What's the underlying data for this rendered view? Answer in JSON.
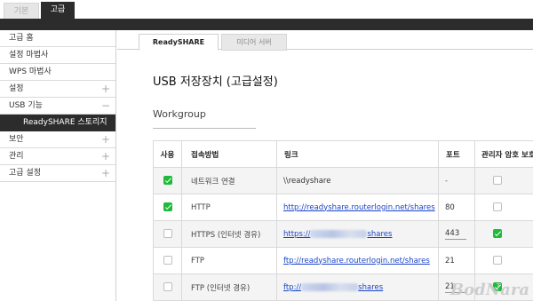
{
  "top_tabs": {
    "basic": "기본",
    "advanced": "고급"
  },
  "sidebar": {
    "items": [
      {
        "label": "고급 홈",
        "has_toggle": false
      },
      {
        "label": "설정 마법사",
        "has_toggle": false
      },
      {
        "label": "WPS 마법사",
        "has_toggle": false
      },
      {
        "label": "설정",
        "toggle": "+"
      },
      {
        "label": "USB 기능",
        "toggle": "−"
      },
      {
        "label": "보안",
        "toggle": "+"
      },
      {
        "label": "관리",
        "toggle": "+"
      },
      {
        "label": "고급 설정",
        "toggle": "+"
      }
    ],
    "active_sub_item": "ReadySHARE 스토리지"
  },
  "sub_tabs": {
    "readyshare": "ReadySHARE",
    "media": "미디어 서버"
  },
  "page_title": "USB 저장장치 (고급설정)",
  "section_label": "Workgroup",
  "table": {
    "headers": {
      "use": "사용",
      "method": "접속방법",
      "link": "링크",
      "port": "포트",
      "protect": "관리자 암호 보호"
    },
    "rows": [
      {
        "use": true,
        "method": "네트워크 연결",
        "link": "\\\\readyshare",
        "link_is_url": false,
        "port": "-",
        "protect": false
      },
      {
        "use": true,
        "method": "HTTP",
        "link": "http://readyshare.routerlogin.net/shares",
        "link_is_url": true,
        "port": "80",
        "protect": false
      },
      {
        "use": false,
        "method": "HTTPS (인터넷 경유)",
        "link_prefix": "https://",
        "link_suffix": "shares",
        "port": "443",
        "protect": true
      },
      {
        "use": false,
        "method": "FTP",
        "link": "ftp://readyshare.routerlogin.net/shares",
        "link_is_url": true,
        "port": "21",
        "protect": false
      },
      {
        "use": false,
        "method": "FTP (인터넷 경유)",
        "link_prefix": "ftp://",
        "link_suffix": "shares",
        "port": "21",
        "protect": true
      }
    ]
  },
  "watermark": "BodNara",
  "colors": {
    "dark_bar": "#2c2c2c",
    "check_green": "#1fba3c",
    "link_blue": "#1a43c7"
  }
}
